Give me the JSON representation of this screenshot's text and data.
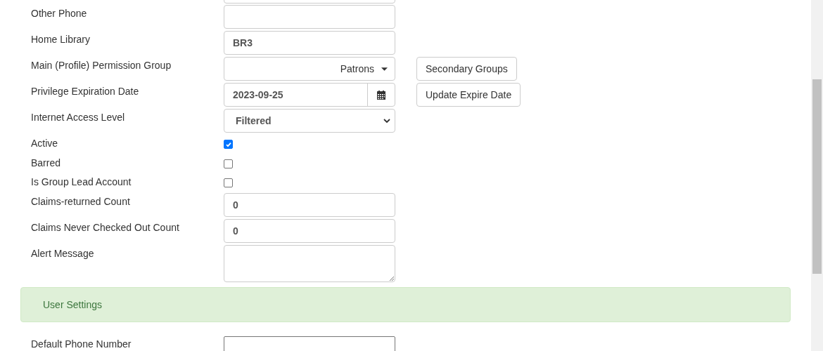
{
  "fields": [
    {
      "kind": "text",
      "label": "Other Phone"
    },
    {
      "kind": "text",
      "label": "Home Library",
      "value": "BR3"
    },
    {
      "kind": "dropdown",
      "label": "Main (Profile) Permission Group",
      "value": "Patrons",
      "button": "Secondary Groups"
    },
    {
      "kind": "date",
      "label": "Privilege Expiration Date",
      "value": "2023-09-25",
      "button": "Update Expire Date"
    },
    {
      "kind": "select",
      "label": "Internet Access Level",
      "value": "Filtered"
    },
    {
      "kind": "checkbox",
      "label": "Active",
      "checked": true
    },
    {
      "kind": "checkbox",
      "label": "Barred",
      "checked": false
    },
    {
      "kind": "checkbox",
      "label": "Is Group Lead Account",
      "checked": false
    },
    {
      "kind": "text",
      "label": "Claims-returned Count",
      "value": "0"
    },
    {
      "kind": "text",
      "label": "Claims Never Checked Out Count",
      "value": "0"
    },
    {
      "kind": "textarea",
      "label": "Alert Message"
    }
  ],
  "section": {
    "title": "User Settings"
  },
  "settings": [
    {
      "kind": "plain",
      "label": "Default Phone Number"
    }
  ]
}
